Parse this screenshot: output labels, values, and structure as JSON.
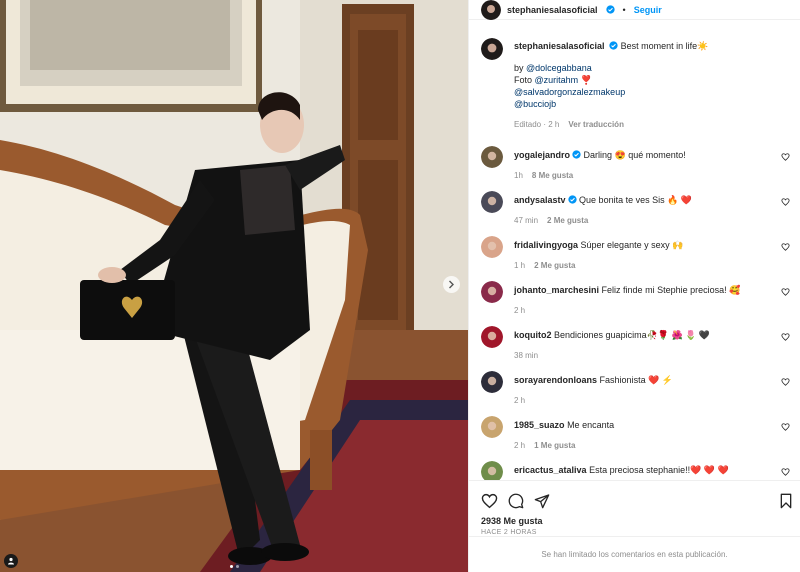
{
  "post": {
    "username": "stephaniesalasoficial",
    "follow_label": "Seguir",
    "separator": "•",
    "caption_text": "Best moment in life",
    "caption_emoji": "☀️",
    "caption_by": "by ",
    "brand_mention": "@dolcegabbana",
    "foto_label": "Foto ",
    "photo_mention": "@zuritahm",
    "photo_emoji": "❣️",
    "makeup_mention": "@salvadorgonzalezmakeup",
    "stylist_mention": "@bucciojb",
    "edited_label": "Editado · 2 h",
    "translate_label": "Ver traducción",
    "likes": "2938 Me gusta",
    "time_ago": "HACE 2 HORAS",
    "comments_limited": "Se han limitado los comentarios en esta publicación.",
    "carousel": {
      "slides": 2,
      "active_index": 0
    }
  },
  "comments": [
    {
      "user": "yogalejandro",
      "verified": true,
      "text": "Darling 😍 qué momento!",
      "time": "1h",
      "likes": "8 Me gusta",
      "avatar_color": "#6b5a3e"
    },
    {
      "user": "andysalastv",
      "verified": true,
      "text": "Que bonita te ves Sis 🔥 ❤️",
      "time": "47 min",
      "likes": "2 Me gusta",
      "avatar_color": "#4a4a58"
    },
    {
      "user": "fridalivingyoga",
      "verified": false,
      "text": "Súper elegante y sexy 🙌",
      "time": "1 h",
      "likes": "2 Me gusta",
      "avatar_color": "#d9a48a"
    },
    {
      "user": "johanto_marchesini",
      "verified": false,
      "text": "Feliz finde mi Stephie preciosa! 🥰",
      "time": "2 h",
      "likes": "",
      "avatar_color": "#8a2a4a"
    },
    {
      "user": "koquito2",
      "verified": false,
      "text": "Bendiciones guapicima🥀🌹 🌺 🌷 🖤",
      "time": "38 min",
      "likes": "",
      "avatar_color": "#a0162a"
    },
    {
      "user": "sorayarendonloans",
      "verified": false,
      "text": "Fashionista ❤️ ⚡",
      "time": "2 h",
      "likes": "",
      "avatar_color": "#2d2d3a"
    },
    {
      "user": "1985_suazo",
      "verified": false,
      "text": "Me encanta",
      "time": "2 h",
      "likes": "1 Me gusta",
      "avatar_color": "#c8a46e"
    },
    {
      "user": "ericactus_ataliva",
      "verified": false,
      "text": "Esta preciosa stephanie!!❤️ ❤️ ❤️",
      "time": "",
      "likes": "",
      "avatar_color": "#6f8d4a"
    }
  ],
  "icons": {
    "heart": "heart-icon",
    "comment": "comment-icon",
    "share": "share-icon",
    "bookmark": "bookmark-icon",
    "verified": "verified-badge-icon",
    "next": "chevron-right-icon",
    "tag": "user-tag-icon"
  },
  "colors": {
    "link": "#00376b",
    "follow": "#0095f6",
    "verified": "#0095f6",
    "muted": "#8e8e8e"
  }
}
